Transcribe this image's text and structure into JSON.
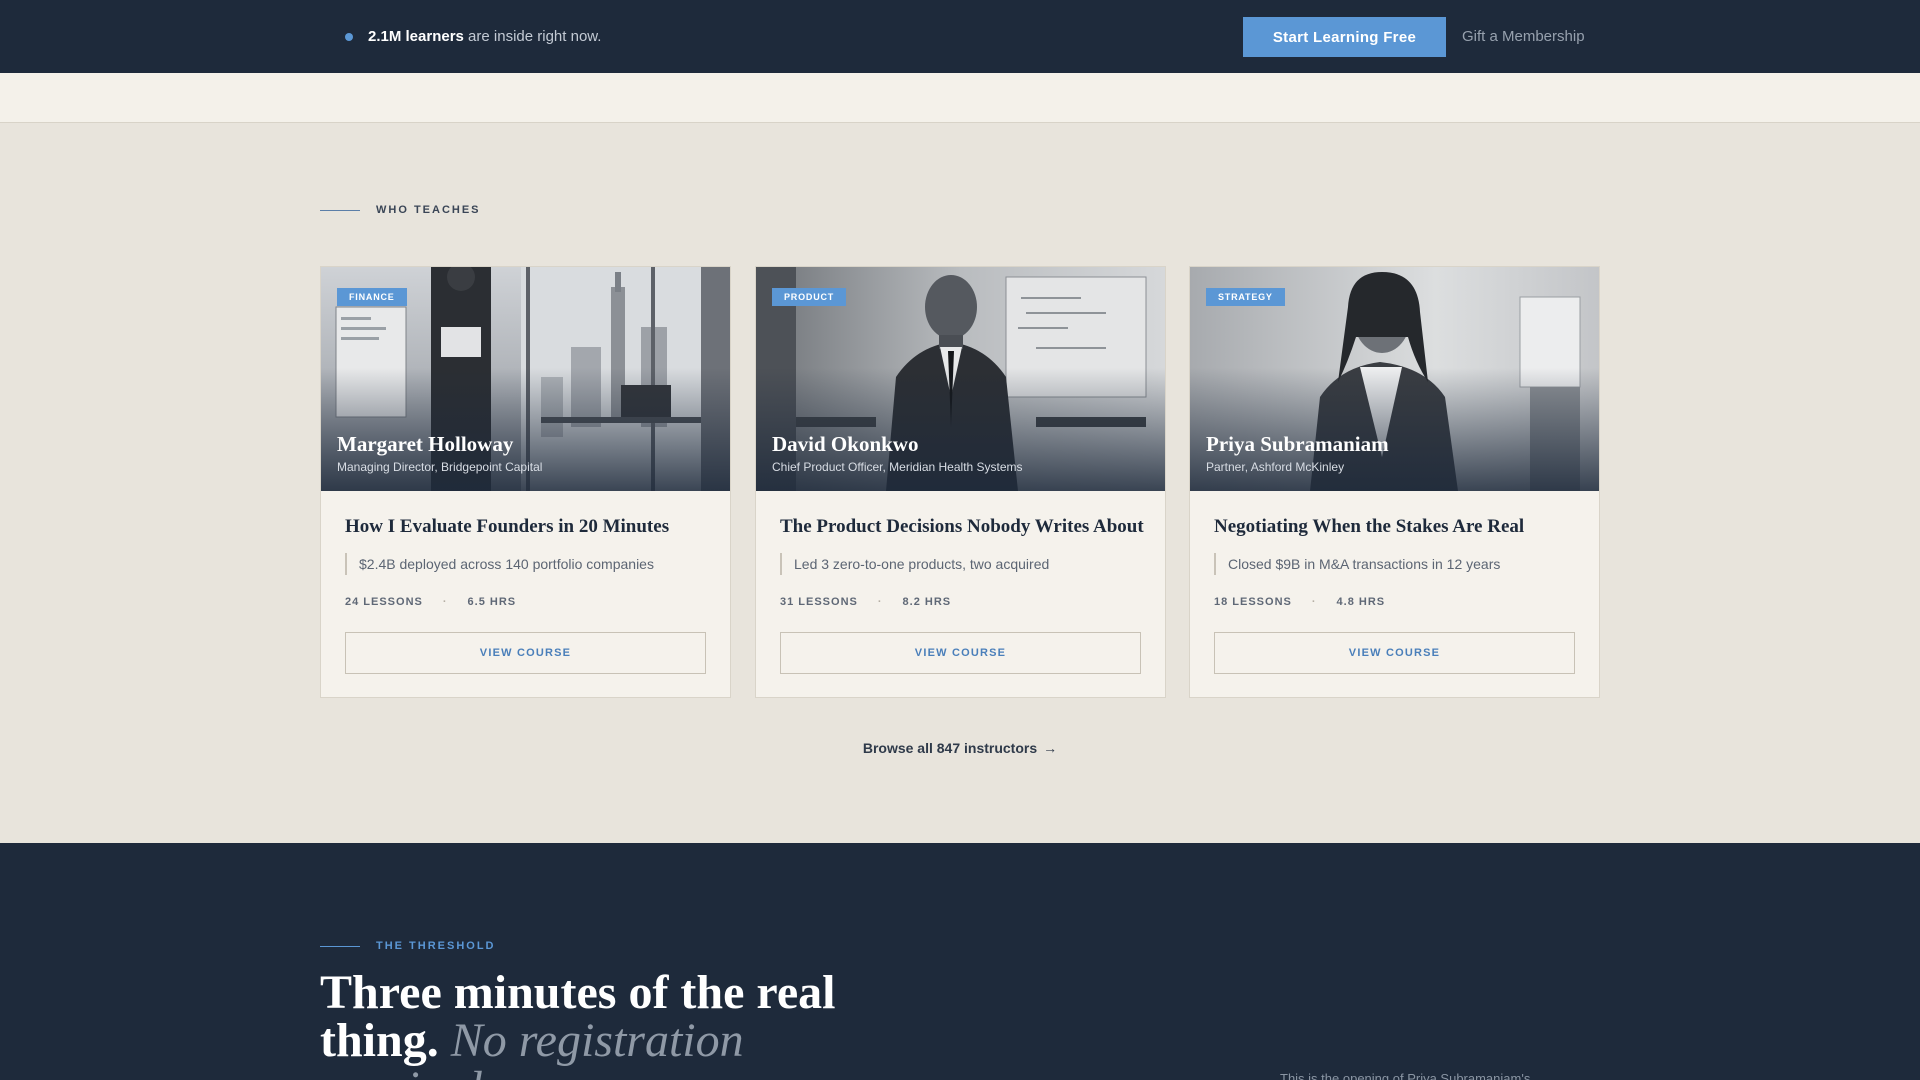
{
  "topbar": {
    "learners_bold": "2.1M learners",
    "learners_rest": " are inside right now.",
    "cta_label": "Start Learning Free",
    "gift_label": "Gift a Membership"
  },
  "teachers_section": {
    "label": "WHO TEACHES",
    "cards": [
      {
        "category": "FINANCE",
        "instructor": "Margaret Holloway",
        "role": "Managing Director, Bridgepoint Capital",
        "course_title": "How I Evaluate Founders in 20 Minutes",
        "credential": "$2.4B deployed across 140 portfolio companies",
        "lessons": "24 LESSONS",
        "hours": "6.5 HRS",
        "button_label": "VIEW COURSE"
      },
      {
        "category": "PRODUCT",
        "instructor": "David Okonkwo",
        "role": "Chief Product Officer, Meridian Health Systems",
        "course_title": "The Product Decisions Nobody Writes About",
        "credential": "Led 3 zero-to-one products, two acquired",
        "lessons": "31 LESSONS",
        "hours": "8.2 HRS",
        "button_label": "VIEW COURSE"
      },
      {
        "category": "STRATEGY",
        "instructor": "Priya Subramaniam",
        "role": "Partner, Ashford McKinley",
        "course_title": "Negotiating When the Stakes Are Real",
        "credential": "Closed $9B in M&A transactions in 12 years",
        "lessons": "18 LESSONS",
        "hours": "4.8 HRS",
        "button_label": "VIEW COURSE"
      }
    ],
    "separator": "·",
    "browse_label": "Browse all 847 instructors",
    "browse_arrow": "→"
  },
  "threshold_section": {
    "label": "THE THRESHOLD",
    "headline_bold": "Three minutes of the real thing.",
    "headline_italic": "No registration required.",
    "teaser": "This is the opening of Priya Subramaniam's"
  },
  "colors": {
    "navy": "#1e2a3b",
    "accent_blue": "#5b97d5",
    "page_bg": "#e8e4dc",
    "card_bg": "#f5f2ec"
  },
  "icons": {
    "live_indicator": "dot-icon",
    "browse_arrow": "arrow-right-icon"
  }
}
